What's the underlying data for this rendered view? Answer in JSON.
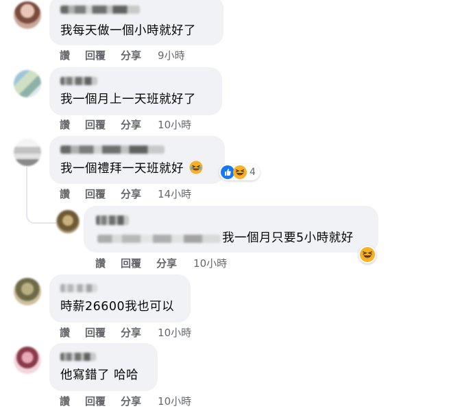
{
  "actions": {
    "like": "讚",
    "reply": "回覆",
    "share": "分享"
  },
  "comments": [
    {
      "text": "我每天做一個小時就好了",
      "time": "9小時"
    },
    {
      "text": "我一個月上一天班就好了",
      "time": "10小時"
    },
    {
      "text": "我一個禮拜一天班就好",
      "time": "14小時",
      "reaction_count": "4"
    },
    {
      "text": "我一個月只要5小時就好",
      "time": "10小時"
    },
    {
      "text": "時薪26600我也可以",
      "time": "10小時"
    },
    {
      "text": "他寫錯了 哈哈",
      "time": "10小時"
    }
  ],
  "colors": {
    "bubble": "#f0f2f5",
    "action_text": "#65676b",
    "like_blue": "#1877f2",
    "emoji_yellow": "#f7b125"
  },
  "icons": [
    "like-reaction-icon",
    "haha-reaction-icon",
    "laughing-emoji-icon"
  ]
}
